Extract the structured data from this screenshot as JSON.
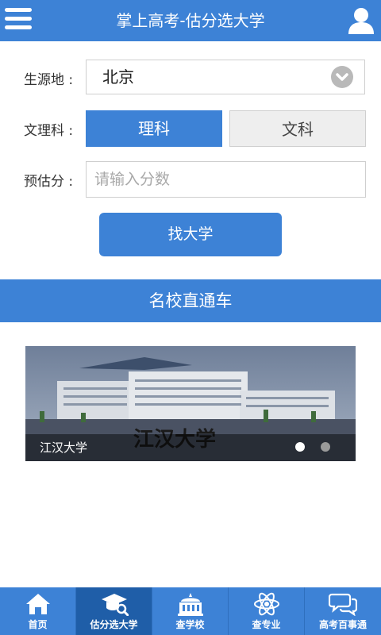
{
  "header": {
    "title": "掌上高考-估分选大学",
    "menu_icon": "menu-icon",
    "user_icon": "user-icon"
  },
  "form": {
    "source_label": "生源地 :",
    "source_value": "北京",
    "subject_label": "文理科 :",
    "subject_options": [
      "理科",
      "文科"
    ],
    "subject_selected": "理科",
    "score_label": "预估分 :",
    "score_placeholder": "请输入分数",
    "search_button": "找大学"
  },
  "section": {
    "title": "名校直通车"
  },
  "banner": {
    "caption": "江汉大学",
    "slides": 2,
    "active_slide": 1
  },
  "bottom_nav": {
    "items": [
      {
        "label": "首页",
        "icon": "home-icon"
      },
      {
        "label": "估分选大学",
        "icon": "graduation-cap-search-icon"
      },
      {
        "label": "查学校",
        "icon": "school-building-icon"
      },
      {
        "label": "查专业",
        "icon": "atom-icon"
      },
      {
        "label": "高考百事通",
        "icon": "chat-bubbles-icon"
      }
    ],
    "active": "估分选大学"
  },
  "colors": {
    "primary": "#3d82d6",
    "active_nav": "#1f5ea8"
  }
}
